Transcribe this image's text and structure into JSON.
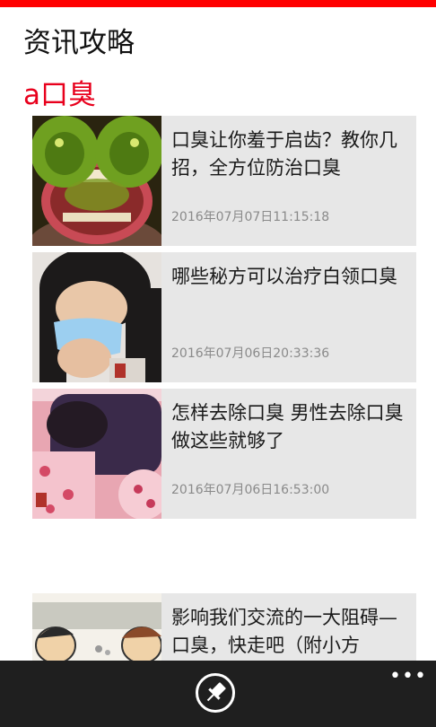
{
  "app": {
    "title": "资讯攻略"
  },
  "section": {
    "title": "a口臭"
  },
  "articles": [
    {
      "title": "口臭让你羞于启齿？教你几招，全方位防治口臭",
      "time": "2016年07月07日11:15:18",
      "thumb": "green-monsters-mouth-image"
    },
    {
      "title": "哪些秘方可以治疗白领口臭",
      "time": "2016年07月06日20:33:36",
      "thumb": "woman-with-mask-image"
    },
    {
      "title": "怎样去除口臭 男性去除口臭做这些就够了",
      "time": "2016年07月06日16:53:00",
      "thumb": "bedding-image"
    },
    {
      "title": "影响我们交流的一大阻碍—口臭，快走吧（附小方",
      "time": "",
      "thumb": "cartoon-couple-image"
    }
  ],
  "app_bar": {
    "pin_icon": "pin-icon",
    "more_label": "•••"
  },
  "colors": {
    "accent": "#ff0000",
    "section_title": "#e8001c",
    "card_bg": "#e7e7e7",
    "app_bar": "#1f1f1f"
  }
}
